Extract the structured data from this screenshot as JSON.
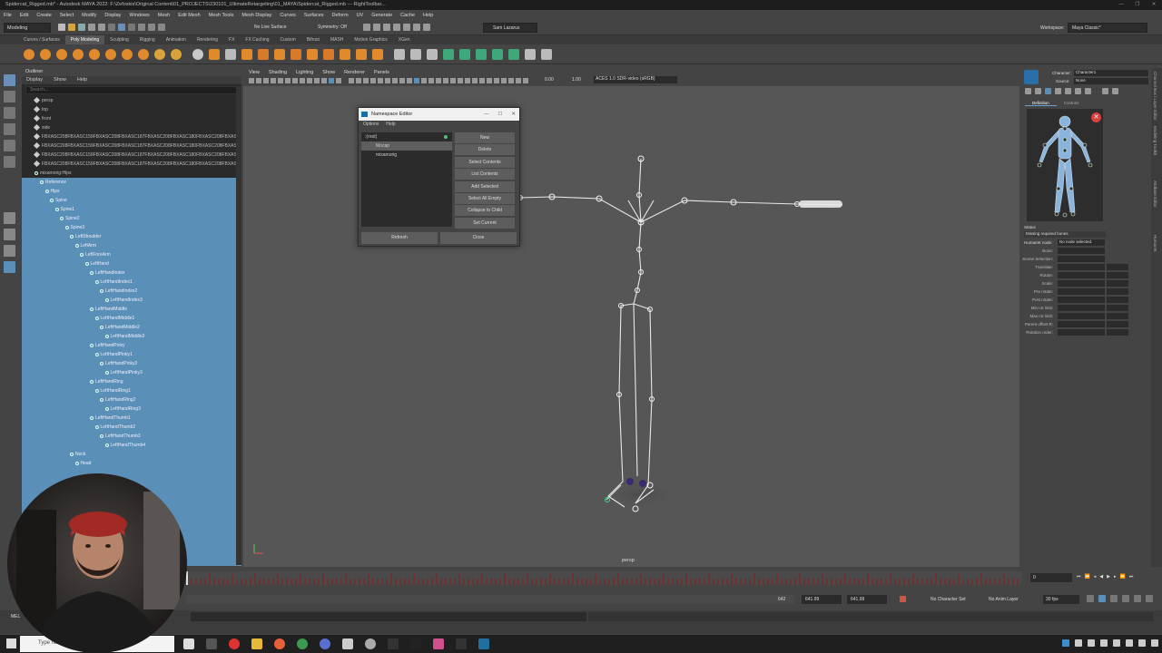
{
  "window": {
    "title": "Spidercat_Rigged.mb* - Autodesk MAYA 2022: F:\\Zefoskis\\Original Content\\01_PROJECTS\\230101_UltimateRetargeting\\01_MAYA\\Spidercat_Rigged.mb   ---   RightToolbar...",
    "controls": [
      "—",
      "❐",
      "✕"
    ]
  },
  "menubar": [
    "File",
    "Edit",
    "Create",
    "Select",
    "Modify",
    "Display",
    "Windows",
    "Mesh",
    "Edit Mesh",
    "Mesh Tools",
    "Mesh Display",
    "Curves",
    "Surfaces",
    "Deform",
    "UV",
    "Generate",
    "Cache",
    "Help"
  ],
  "statusline": {
    "mode": "Modeling",
    "live_surface": "No Live Surface",
    "symmetry": "Symmetry: Off",
    "user": "Sam Lazarus",
    "workspace_label": "Workspace:",
    "workspace_value": "Maya Classic*"
  },
  "shelf_tabs": [
    "Curves / Surfaces",
    "Poly Modeling",
    "Sculpting",
    "Rigging",
    "Animation",
    "Rendering",
    "FX",
    "FX Caching",
    "Custom",
    "Bifrost",
    "MASH",
    "Motion Graphics",
    "XGen"
  ],
  "shelf_active": "Poly Modeling",
  "outliner": {
    "title": "Outliner",
    "menu": [
      "Display",
      "Show",
      "Help"
    ],
    "search_placeholder": "Search...",
    "top_rows": [
      {
        "label": "persp",
        "type": "cam"
      },
      {
        "label": "top",
        "type": "cam"
      },
      {
        "label": "front",
        "type": "cam"
      },
      {
        "label": "side",
        "type": "cam"
      },
      {
        "label": "FBXASC208FBXASC159FBXASC208FBXASC187FBXASC208FBXASC180FBXASC208FBXASC180FBXASC208FBXASC187FBXASC208FBXASC183FBXASC209FBXASC128",
        "type": "mesh"
      },
      {
        "label": "FBXASC208FBXASC159FBXASC208FBXASC187FBXASC208FBXASC180FBXASC208FBXASC180FBXASC208FBXASC187FBXASC208FBXASC183FBXASC209FBXASC128",
        "type": "mesh"
      },
      {
        "label": "FBXASC208FBXASC159FBXASC208FBXASC187FBXASC208FBXASC180FBXASC208FBXASC180FBXASC208FBXASC187FBXASC208FBXASC183FBXASC209FBXASC128",
        "type": "mesh"
      },
      {
        "label": "FBXASC208FBXASC159FBXASC208FBXASC187FBXASC208FBXASC180FBXASC208FBXASC180FBXASC208FBXASC187FBXASC208FBXASC183FBXASC209FBXASC128",
        "type": "mesh"
      },
      {
        "label": "mixamorig:Hips",
        "type": "joint"
      }
    ],
    "tree": [
      {
        "label": "Reference",
        "depth": 0
      },
      {
        "label": "Hips",
        "depth": 1
      },
      {
        "label": "Spine",
        "depth": 2
      },
      {
        "label": "Spine1",
        "depth": 3
      },
      {
        "label": "Spine2",
        "depth": 4
      },
      {
        "label": "Spine3",
        "depth": 5
      },
      {
        "label": "LeftShoulder",
        "depth": 6
      },
      {
        "label": "LeftArm",
        "depth": 7
      },
      {
        "label": "LeftForeArm",
        "depth": 8
      },
      {
        "label": "LeftHand",
        "depth": 9
      },
      {
        "label": "LeftHandIndex",
        "depth": 10
      },
      {
        "label": "LeftHandIndex1",
        "depth": 11
      },
      {
        "label": "LeftHandIndex2",
        "depth": 12
      },
      {
        "label": "LeftHandIndex3",
        "depth": 13
      },
      {
        "label": "LeftHandMiddle",
        "depth": 10
      },
      {
        "label": "LeftHandMiddle1",
        "depth": 11
      },
      {
        "label": "LeftHandMiddle2",
        "depth": 12
      },
      {
        "label": "LeftHandMiddle3",
        "depth": 13
      },
      {
        "label": "LeftHandPinky",
        "depth": 10
      },
      {
        "label": "LeftHandPinky1",
        "depth": 11
      },
      {
        "label": "LeftHandPinky2",
        "depth": 12
      },
      {
        "label": "LeftHandPinky3",
        "depth": 13
      },
      {
        "label": "LeftHandRing",
        "depth": 10
      },
      {
        "label": "LeftHandRing1",
        "depth": 11
      },
      {
        "label": "LeftHandRing2",
        "depth": 12
      },
      {
        "label": "LeftHandRing3",
        "depth": 13
      },
      {
        "label": "LeftHandThumb1",
        "depth": 10
      },
      {
        "label": "LeftHandThumb2",
        "depth": 11
      },
      {
        "label": "LeftHandThumb3",
        "depth": 12
      },
      {
        "label": "LeftHandThumb4",
        "depth": 13
      },
      {
        "label": "Neck",
        "depth": 6
      },
      {
        "label": "Head",
        "depth": 7
      }
    ]
  },
  "viewport": {
    "menu": [
      "View",
      "Shading",
      "Lighting",
      "Show",
      "Renderer",
      "Panels"
    ],
    "field_a": "0.00",
    "field_b": "1.00",
    "colorspace": "ACES 1.0 SDR-video (sRGB)",
    "camera_label": "persp"
  },
  "namespace_editor": {
    "title": "Namespace Editor",
    "menu": [
      "Options",
      "Help"
    ],
    "items": [
      {
        "label": ":(root)",
        "selected": false,
        "depth": 0
      },
      {
        "label": "Mocap",
        "selected": true,
        "depth": 1
      },
      {
        "label": "mixamorig",
        "selected": false,
        "depth": 1
      }
    ],
    "buttons": [
      "New",
      "Delete",
      "Select Contents",
      "List Contents",
      "Add Selected",
      "Select All Empty",
      "Collapse to Child",
      "Set Current"
    ],
    "refresh": "Refresh",
    "close": "Close"
  },
  "hik": {
    "character_label": "Character:",
    "character_value": "Character1",
    "source_label": "Source:",
    "source_value": "None",
    "tabs": [
      "Definition",
      "Controls"
    ],
    "status_label": "Status",
    "status_value": "Missing required bones",
    "node_label": "HumanIK node:",
    "node_value": "No node selected.",
    "attrs": [
      "Bone:",
      "Scene Selection:",
      "Translate:",
      "Rotate:",
      "Scale:",
      "Pre rotate:",
      "Post rotate:",
      "Min rot limit:",
      "Max rot limit:",
      "Parent offset R:",
      "Rotation order:"
    ]
  },
  "right_strip": [
    "Channel Box / Layer Editor",
    "Modeling Toolkit",
    "Attribute Editor",
    "HumanIK"
  ],
  "timeline": {
    "current_frame": "0"
  },
  "range": {
    "end_frame": "642",
    "range_a": "641.99",
    "range_b": "641.99",
    "character_set": "No Character Set",
    "anim_layer": "No Anim Layer",
    "fps": "30 fps"
  },
  "cmdline": {
    "label": "MEL"
  },
  "taskbar": {
    "search_placeholder": "Type here to search"
  },
  "colors": {
    "selection_blue": "#5a8fb8",
    "viewport_bg": "#565656",
    "panel_bg": "#444444",
    "timeline_red": "#8a1a1a"
  }
}
